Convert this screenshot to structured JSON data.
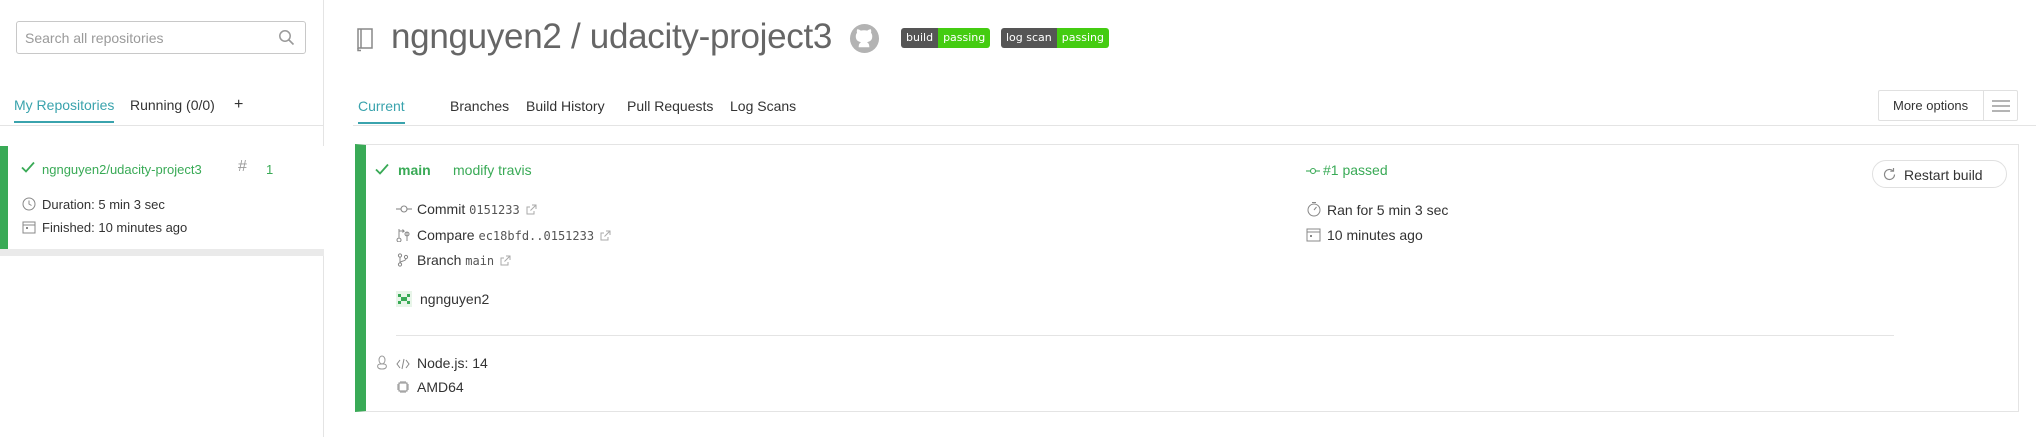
{
  "search": {
    "placeholder": "Search all repositories"
  },
  "sidebar": {
    "tabs": [
      {
        "label": "My Repositories",
        "active": true
      },
      {
        "label": "Running (0/0)",
        "active": false
      },
      {
        "label": "+",
        "active": false
      }
    ],
    "repo": {
      "name": "ngnguyen2/udacity-project3",
      "hash_symbol": "#",
      "build_number": "1",
      "duration": "Duration: 5 min 3 sec",
      "finished": "Finished: 10 minutes ago",
      "status_color": "#39aa56"
    }
  },
  "header": {
    "title": "ngnguyen2 / udacity-project3",
    "badges": [
      {
        "left": "build",
        "right": "passing"
      },
      {
        "left": "log scan",
        "right": "passing"
      }
    ]
  },
  "main_tabs": [
    {
      "label": "Current",
      "active": true
    },
    {
      "label": "Branches",
      "active": false
    },
    {
      "label": "Build History",
      "active": false
    },
    {
      "label": "Pull Requests",
      "active": false
    },
    {
      "label": "Log Scans",
      "active": false
    }
  ],
  "more_options": {
    "label": "More options"
  },
  "build": {
    "branch": "main",
    "message": "modify travis",
    "status": "#1 passed",
    "commit_label": "Commit",
    "commit_sha": "0151233",
    "compare_label": "Compare",
    "compare_range": "ec18bfd..0151233",
    "branch_label": "Branch",
    "branch_name": "main",
    "author": "ngnguyen2",
    "ran_for": "Ran for 5 min 3 sec",
    "time_ago": "10 minutes ago",
    "restart_label": "Restart build",
    "language": "Node.js: 14",
    "arch": "AMD64"
  },
  "colors": {
    "accent": "#3aa3ad",
    "passed": "#39aa56",
    "badge_dark": "#555555",
    "badge_green": "#44cc11"
  },
  "icons": [
    "search-icon",
    "check-icon",
    "clock-icon",
    "calendar-icon",
    "book-icon",
    "github-icon",
    "commit-icon",
    "compare-icon",
    "branch-icon",
    "external-link-icon",
    "stopwatch-icon",
    "restart-icon",
    "menu-icon",
    "linux-icon",
    "code-icon",
    "chip-icon"
  ]
}
